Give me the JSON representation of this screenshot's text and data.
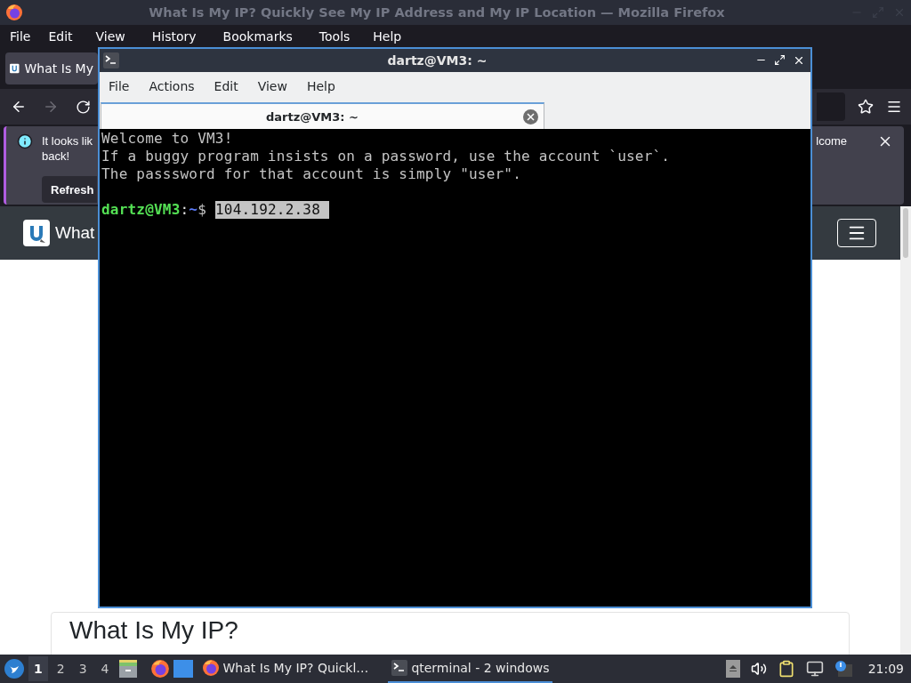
{
  "firefox": {
    "title": "What Is My IP? Quickly See My IP Address and My IP Location — Mozilla Firefox",
    "menu": [
      "File",
      "Edit",
      "View",
      "History",
      "Bookmarks",
      "Tools",
      "Help"
    ],
    "tabs": [
      {
        "label": "What Is My",
        "selected": true
      }
    ],
    "nav": [
      {
        "kind": "back",
        "disabled": false
      },
      {
        "kind": "forward",
        "disabled": true
      },
      {
        "kind": "reload",
        "disabled": false
      }
    ],
    "notification": {
      "text_line1": "It looks lik",
      "text_line2": "back!",
      "text_end": "lcome",
      "button": "Refresh"
    },
    "site_header": {
      "brand": "What"
    },
    "page": {
      "heading": "What Is My IP?"
    }
  },
  "terminal": {
    "title": "dartz@VM3: ~",
    "menu": [
      "File",
      "Actions",
      "Edit",
      "View",
      "Help"
    ],
    "tabs": [
      {
        "label": "dartz@VM3: ~",
        "selected": true
      }
    ],
    "lines": [
      "Welcome to VM3!",
      "If a buggy program insists on a password, use the account `user`.",
      "The passsword for that account is simply \"user\"."
    ],
    "prompt": {
      "user_host": "dartz@VM3",
      "separator": ":",
      "path": "~",
      "symbol": "$",
      "input": "104.192.2.38 ",
      "selected": true
    }
  },
  "taskbar": {
    "workspaces": [
      {
        "label": "1",
        "selected": true
      },
      {
        "label": "2",
        "selected": false
      },
      {
        "label": "3",
        "selected": false
      },
      {
        "label": "4",
        "selected": false
      }
    ],
    "tasks": [
      {
        "kind": "browser",
        "label": "What Is My IP? Quickl…",
        "selected": false
      },
      {
        "kind": "terminal",
        "label": "qterminal - 2 windows",
        "selected": true
      }
    ],
    "clock": "21:09"
  }
}
